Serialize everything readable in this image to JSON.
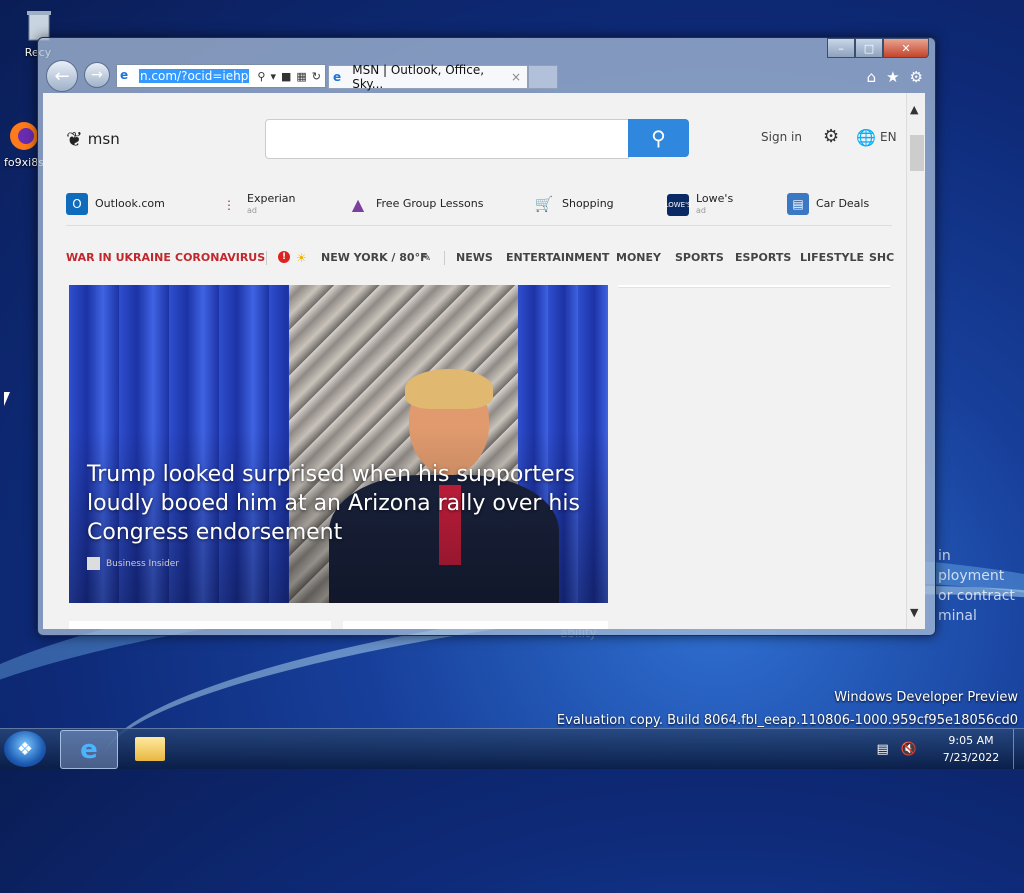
{
  "desktop": {
    "icons": [
      {
        "label": "Recy"
      },
      {
        "label": "fo9xi8s"
      }
    ],
    "watermark_line1": "Windows Developer Preview",
    "watermark_line2": "Evaluation copy. Build 8064.fbl_eeap.110806-1000.959cf95e18056cd0",
    "background_text": [
      "in",
      "ployment",
      "or contract",
      "minal"
    ],
    "background_text2": "ability"
  },
  "browser": {
    "window_controls": {
      "minimize": "–",
      "maximize": "□",
      "close": "✕"
    },
    "back_icon": "back-arrow-icon",
    "forward_icon": "forward-arrow-icon",
    "address": {
      "url": "n.com/?ocid=iehp"
    },
    "tab": {
      "title": "MSN | Outlook, Office, Sky...",
      "close": "×"
    }
  },
  "page": {
    "header": {
      "logo": "msn",
      "search_placeholder": "",
      "signin": "Sign in",
      "lang": "EN"
    },
    "quicklinks": [
      {
        "label": "Outlook.com",
        "ad": "",
        "icon": "outlook-icon",
        "color": "#0f6cbd"
      },
      {
        "label": "Experian",
        "ad": "ad",
        "icon": "experian-icon",
        "color": "#ffffff"
      },
      {
        "label": "Free Group Lessons",
        "ad": "",
        "icon": "graduation-cap-icon",
        "color": "#7b3fa0"
      },
      {
        "label": "Shopping",
        "ad": "",
        "icon": "shopping-cart-icon",
        "color": "#1a73e8"
      },
      {
        "label": "Lowe's",
        "ad": "ad",
        "icon": "lowes-icon",
        "color": "#0a2a66"
      },
      {
        "label": "Car Deals",
        "ad": "",
        "icon": "car-icon",
        "color": "#3b78c4"
      }
    ],
    "categories": {
      "war": "WAR IN UKRAINE",
      "corona": "CORONAVIRUS",
      "weather": "NEW YORK / 80°F",
      "items": [
        "NEWS",
        "ENTERTAINMENT",
        "MONEY",
        "SPORTS",
        "ESPORTS",
        "LIFESTYLE",
        "SHC"
      ]
    },
    "hero": {
      "title": "Trump looked surprised when his supporters loudly booed him at an Arizona rally over his Congress endorsement",
      "source": "Business Insider"
    }
  },
  "taskbar": {
    "time": "9:05 AM",
    "date": "7/23/2022"
  }
}
